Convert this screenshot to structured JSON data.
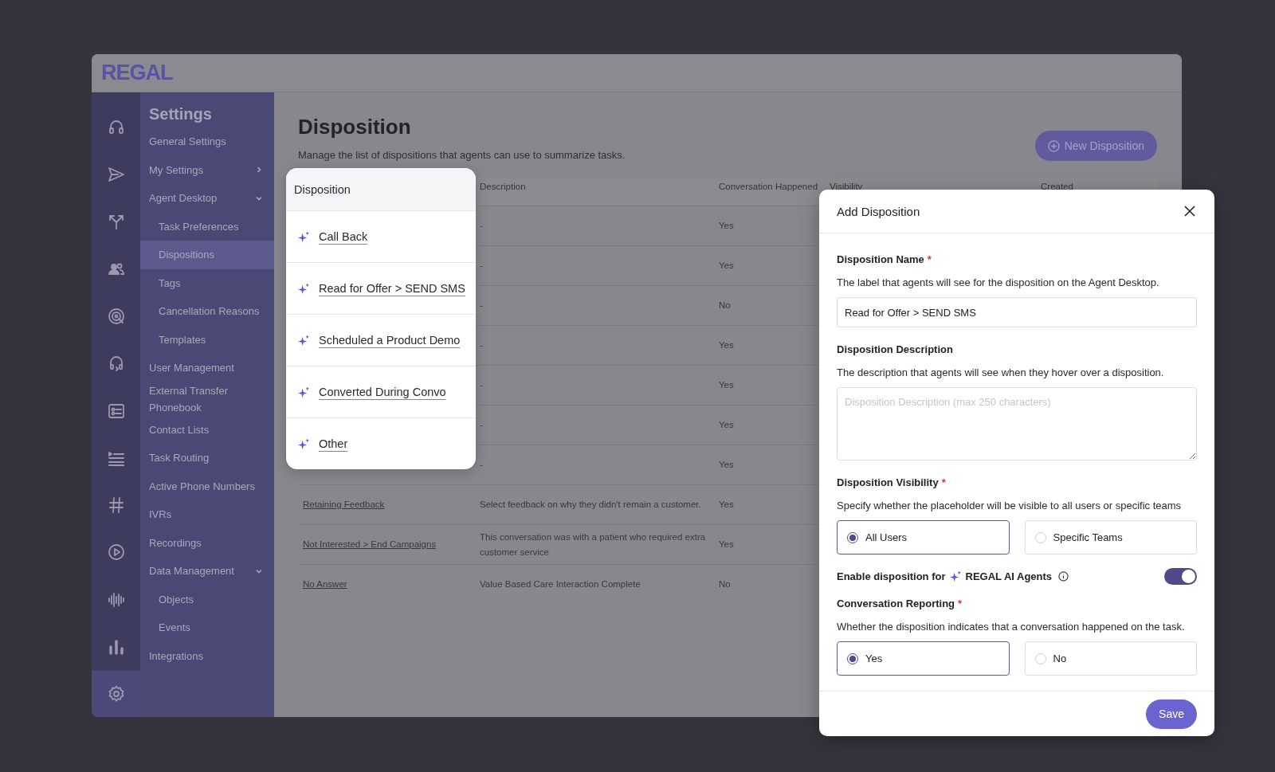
{
  "app": {
    "logo": "REGAL"
  },
  "rail": [
    {
      "selected": false
    },
    {
      "selected": false
    },
    {
      "selected": false
    },
    {
      "selected": false
    },
    {
      "selected": false
    },
    {
      "selected": false
    },
    {
      "selected": false
    },
    {
      "selected": false
    },
    {
      "selected": false
    },
    {
      "selected": false
    },
    {
      "selected": false
    },
    {
      "selected": false
    },
    {
      "selected": true
    }
  ],
  "sidebar": {
    "title": "Settings",
    "items": [
      {
        "label": "General Settings",
        "selected": false
      },
      {
        "label": "My Settings",
        "selected": false,
        "expanded": false
      },
      {
        "label": "Agent Desktop",
        "selected": false,
        "expanded": true,
        "children": [
          {
            "label": "Task Preferences",
            "selected": false
          },
          {
            "label": "Dispositions",
            "selected": true
          },
          {
            "label": "Tags",
            "selected": false
          },
          {
            "label": "Cancellation Reasons",
            "selected": false
          },
          {
            "label": "Templates",
            "selected": false
          }
        ]
      },
      {
        "label": "User Management",
        "selected": false
      },
      {
        "label": "External Transfer Phonebook",
        "selected": false
      },
      {
        "label": "Contact Lists",
        "selected": false
      },
      {
        "label": "Task Routing",
        "selected": false
      },
      {
        "label": "Active Phone Numbers",
        "selected": false
      },
      {
        "label": "IVRs",
        "selected": false
      },
      {
        "label": "Recordings",
        "selected": false
      },
      {
        "label": "Data Management",
        "selected": false,
        "expanded": true,
        "children": [
          {
            "label": "Objects",
            "selected": false
          },
          {
            "label": "Events",
            "selected": false
          }
        ]
      },
      {
        "label": "Integrations",
        "selected": false
      }
    ]
  },
  "page": {
    "title": "Disposition",
    "subtitle": "Manage the list of dispositions that agents can use to summarize tasks.",
    "new_button": "New Disposition"
  },
  "table": {
    "columns": [
      "Description",
      "Conversation Happened",
      "Visibility",
      "Created"
    ],
    "rows": [
      {
        "description": "-",
        "conversation": "Yes"
      },
      {
        "description": "-",
        "conversation": "Yes"
      },
      {
        "description": "-",
        "conversation": "No"
      },
      {
        "description": "-",
        "conversation": "Yes"
      },
      {
        "description": "-",
        "conversation": "Yes"
      },
      {
        "description": "-",
        "conversation": "Yes"
      },
      {
        "description": "-",
        "conversation": "Yes"
      },
      {
        "name": "Retaining Feedback",
        "description": "Select feedback on why they didn't remain a customer.",
        "conversation": "Yes"
      },
      {
        "name": "Not Interested > End Campaigns",
        "description": "This conversation was with a patient who required extra customer service",
        "conversation": "Yes"
      },
      {
        "name": "No Answer",
        "description": "Value Based Care Interaction Complete",
        "conversation": "No"
      }
    ]
  },
  "name_card": {
    "header": "Disposition",
    "items": [
      "Call Back",
      "Read for Offer > SEND SMS",
      "Scheduled a Product Demo",
      "Converted During Convo",
      "Other"
    ]
  },
  "modal": {
    "title": "Add Disposition",
    "name": {
      "label": "Disposition Name",
      "required_mark": "*",
      "help": "The label that agents will see for the disposition on the Agent Desktop.",
      "value": "Read for Offer > SEND SMS"
    },
    "description": {
      "label": "Disposition Description",
      "help": "The description that agents will see when they hover over a disposition.",
      "placeholder": "Disposition Description (max 250 characters)"
    },
    "visibility": {
      "label": "Disposition Visibility",
      "required_mark": "*",
      "help": "Specify whether the placeholder will be visible to all users or specific teams",
      "options": [
        {
          "label": "All Users",
          "selected": true
        },
        {
          "label": "Specific Teams",
          "selected": false
        }
      ]
    },
    "ai_toggle": {
      "label": "Enable disposition for",
      "product": "REGAL AI Agents",
      "on": true
    },
    "reporting": {
      "label": "Conversation Reporting",
      "required_mark": "*",
      "help": "Whether the disposition indicates that a conversation happened on the task.",
      "options": [
        {
          "label": "Yes",
          "selected": true
        },
        {
          "label": "No",
          "selected": false
        }
      ]
    },
    "save_button": "Save"
  }
}
